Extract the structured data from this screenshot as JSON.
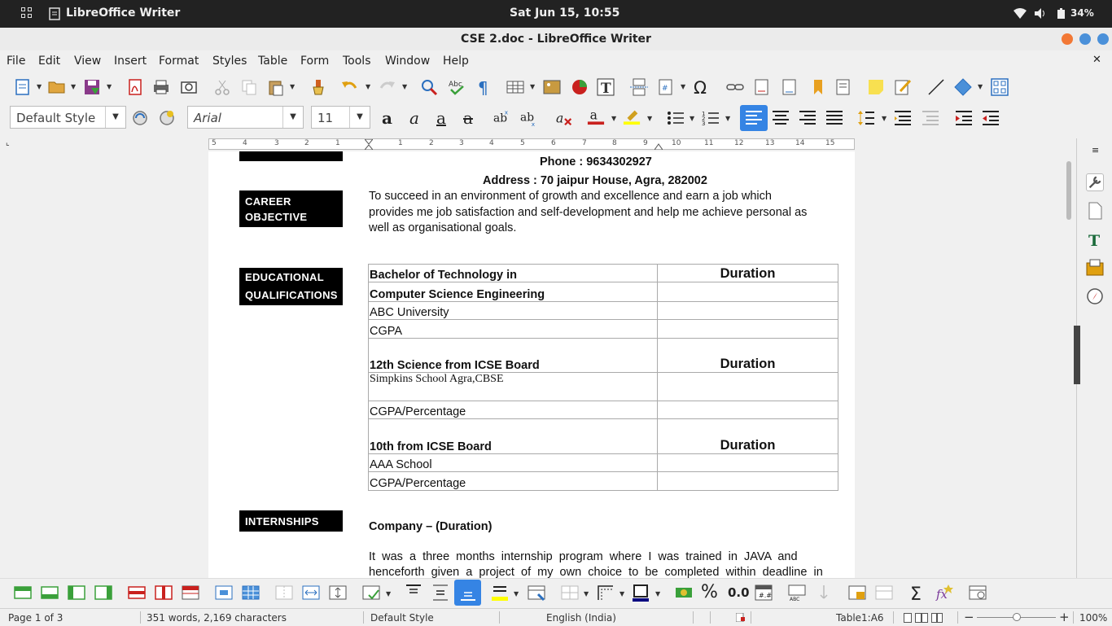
{
  "system_bar": {
    "app_name": "LibreOffice Writer",
    "clock": "Sat Jun 15, 10:55",
    "battery": "34%"
  },
  "window": {
    "title": "CSE 2.doc - LibreOffice Writer",
    "close_glyph": "✕"
  },
  "menu": [
    "File",
    "Edit",
    "View",
    "Insert",
    "Format",
    "Styles",
    "Table",
    "Form",
    "Tools",
    "Window",
    "Help"
  ],
  "formatting": {
    "paragraph_style": "Default Style",
    "font_name": "Arial",
    "font_size": "11"
  },
  "ruler": {
    "labels": [
      "5",
      "4",
      "3",
      "2",
      "1",
      "1",
      "2",
      "3",
      "4",
      "5",
      "6",
      "7",
      "8",
      "9",
      "10",
      "11",
      "12",
      "13",
      "14",
      "15"
    ]
  },
  "document": {
    "phone": "Phone : 9634302927",
    "address": "Address : 70 jaipur House, Agra, 282002",
    "sections": {
      "career_label_1": "CAREER",
      "career_label_2": "OBJECTIVE",
      "career_text_1": "To succeed in an environment of growth and excellence and earn a job which",
      "career_text_2": "provides me job satisfaction and self-development and help me achieve personal as",
      "career_text_3": "well as organisational goals.",
      "edu_label_1": "EDUCATIONAL",
      "edu_label_2": "QUALIFICATIONS",
      "intern_label": "INTERNSHIPS",
      "intern_company": "Company – (Duration)",
      "intern_text_1": "It  was  a  three  months  internship  program  where  I  was  trained  in  JAVA  and",
      "intern_text_2": "henceforth  given  a  project  of  my  own  choice  to  be  completed  within  deadline  in"
    },
    "edu_table": {
      "rows": [
        {
          "left": "Bachelor of Technology in",
          "right": "Duration",
          "style": "bold"
        },
        {
          "left": "Computer Science Engineering",
          "right": "",
          "style": "bold"
        },
        {
          "left": "ABC University",
          "right": "",
          "style": "normal"
        },
        {
          "left": "CGPA",
          "right": "",
          "style": "normal"
        },
        {
          "left": "12th Science from ICSE Board",
          "right": "Duration",
          "style": "bold"
        },
        {
          "left": "Simpkins School Agra,CBSE",
          "right": "",
          "style": "serif"
        },
        {
          "left": "CGPA/Percentage",
          "right": "",
          "style": "normal"
        },
        {
          "left": "10th from ICSE Board",
          "right": "Duration",
          "style": "bold"
        },
        {
          "left": "AAA School",
          "right": "",
          "style": "normal"
        },
        {
          "left": "CGPA/Percentage",
          "right": "",
          "style": "normal"
        }
      ]
    }
  },
  "status": {
    "page": "Page 1 of 3",
    "words": "351 words, 2,169 characters",
    "style": "Default Style",
    "language": "English (India)",
    "table_cell": "Table1:A6",
    "zoom": "100%",
    "zoom_minus": "−",
    "zoom_plus": "+"
  },
  "bottom_toolbar": {
    "percent_glyph": "%",
    "decimal_label": "0.0"
  },
  "colors": {
    "accent": "#3584e4",
    "font_color": "#c9211e",
    "highlight": "#ffff00",
    "border_color": "#000080"
  }
}
